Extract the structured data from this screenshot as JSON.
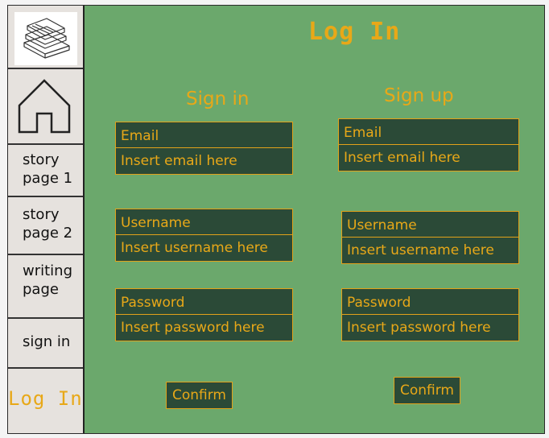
{
  "page": {
    "title": "Log In"
  },
  "sidebar": {
    "logo_icon": "books-stack-icon",
    "home_icon": "home-icon",
    "items": [
      {
        "label": "story page 1"
      },
      {
        "label": "story page 2"
      },
      {
        "label": "writing page"
      },
      {
        "label": "sign in"
      },
      {
        "label": "Log In"
      }
    ]
  },
  "sign_in": {
    "title": "Sign in",
    "email": {
      "label": "Email",
      "placeholder": "Insert email here"
    },
    "username": {
      "label": "Username",
      "placeholder": "Insert username here"
    },
    "password": {
      "label": "Password",
      "placeholder": "Insert password here"
    },
    "confirm_label": "Confirm"
  },
  "sign_up": {
    "title": "Sign up",
    "email": {
      "label": "Email",
      "placeholder": "Insert email here"
    },
    "username": {
      "label": "Username",
      "placeholder": "Insert username here"
    },
    "password": {
      "label": "Password",
      "placeholder": "Insert password here"
    },
    "confirm_label": "Confirm"
  },
  "colors": {
    "accent": "#e8a818",
    "main_bg": "#6ba86c",
    "field_bg": "#2b4a37",
    "sidebar_bg": "#e6e2de"
  }
}
